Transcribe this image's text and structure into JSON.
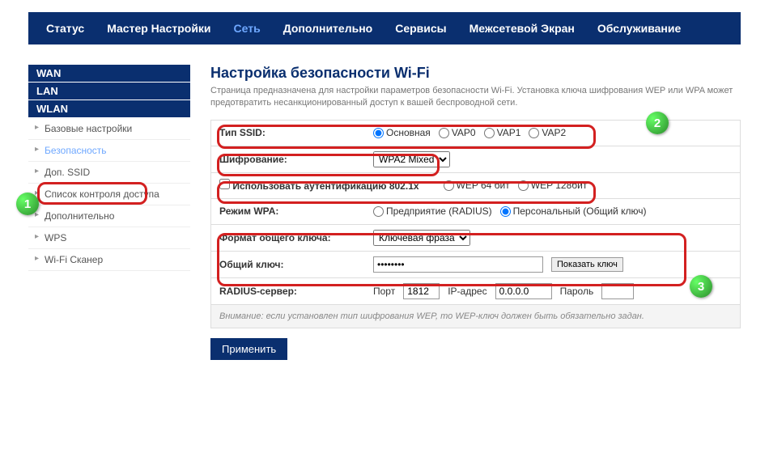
{
  "nav": {
    "items": [
      "Статус",
      "Мастер Настройки",
      "Сеть",
      "Дополнительно",
      "Сервисы",
      "Межсетевой Экран",
      "Обслуживание"
    ]
  },
  "sidebar": {
    "heads": [
      "WAN",
      "LAN",
      "WLAN"
    ],
    "items": [
      "Базовые настройки",
      "Безопасность",
      "Доп. SSID",
      "Список контроля доступа",
      "Дополнительно",
      "WPS",
      "Wi-Fi Сканер"
    ]
  },
  "page": {
    "title": "Настройка безопасности Wi-Fi",
    "desc": "Страница предназначена для настройки параметров безопасности Wi-Fi. Установка ключа шифрования WEP или WPA может предотвратить несанкционированный доступ к вашей беспроводной сети."
  },
  "form": {
    "ssid_type_label": "Тип SSID:",
    "ssid_options": [
      "Основная",
      "VAP0",
      "VAP1",
      "VAP2"
    ],
    "encryption_label": "Шифрование:",
    "encryption_value": "WPA2 Mixed",
    "auth8021x_label": "Использовать аутентификацию 802.1x",
    "wep64": "WEP 64 бит",
    "wep128": "WEP 128бит",
    "wpa_mode_label": "Режим WPA:",
    "wpa_enterprise": "Предприятие (RADIUS)",
    "wpa_personal": "Персональный (Общий ключ)",
    "key_format_label": "Формат общего ключа:",
    "key_format_value": "Ключевая фраза",
    "key_label": "Общий ключ:",
    "key_value": "••••••••",
    "show_key": "Показать ключ",
    "radius_label": "RADIUS-сервер:",
    "radius_port_label": "Порт",
    "radius_port": "1812",
    "radius_ip_label": "IP-адрес",
    "radius_ip": "0.0.0.0",
    "radius_pwd_label": "Пароль",
    "note": "Внимание: если установлен тип шифрования WEP, то WEP-ключ должен быть обязательно задан.",
    "apply": "Применить"
  },
  "badges": {
    "b1": "1",
    "b2": "2",
    "b3": "3"
  }
}
